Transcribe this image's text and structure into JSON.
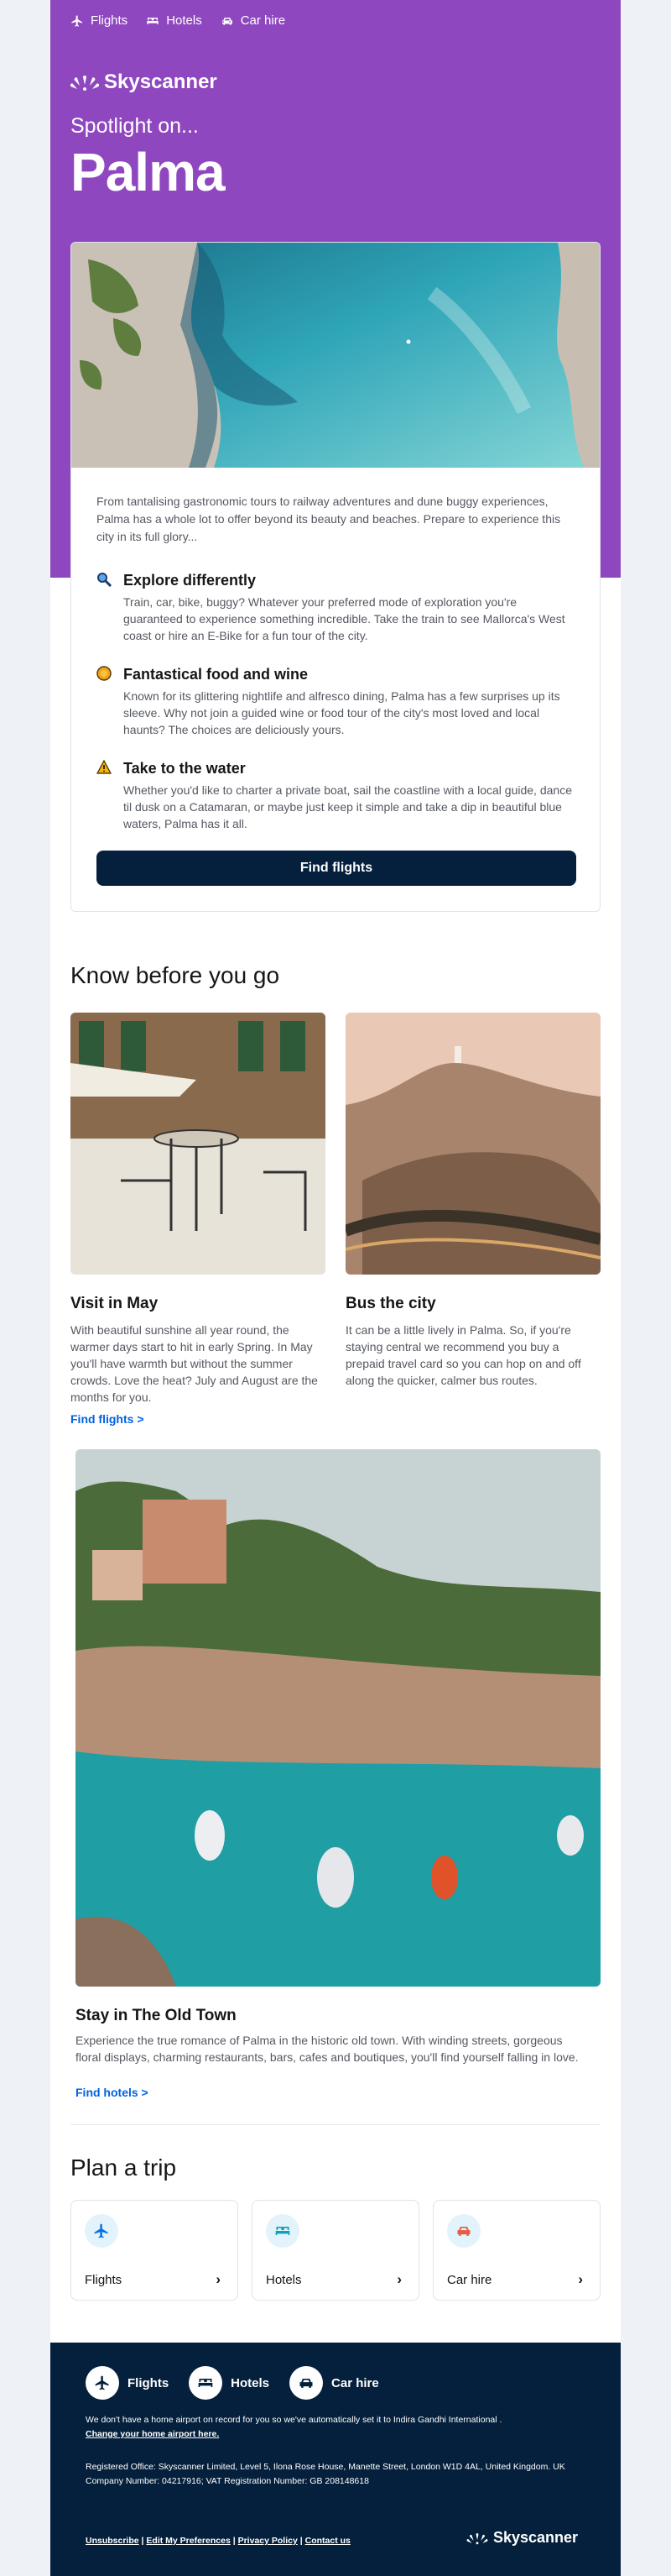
{
  "topnav": {
    "items": [
      {
        "label": "Flights",
        "icon": "plane-icon"
      },
      {
        "label": "Hotels",
        "icon": "bed-icon"
      },
      {
        "label": "Car hire",
        "icon": "car-icon"
      }
    ]
  },
  "brand": {
    "name": "Skyscanner",
    "purple": "#8f47c0",
    "navy": "#05203c",
    "link_blue": "#0062e3"
  },
  "hero": {
    "kicker": "Spotlight on...",
    "city": "Palma"
  },
  "intro": "From tantalising gastronomic tours to railway adventures and dune buggy experiences, Palma has a whole lot to offer beyond its beauty and beaches. Prepare to experience this city in its full glory...",
  "features": [
    {
      "title": "Explore differently",
      "icon": "magnifier-icon",
      "text": "Train, car, bike, buggy? Whatever your preferred mode of exploration you're guaranteed to experience something incredible. Take the train to see Mallorca's West coast or hire an E-Bike for a fun tour of the city."
    },
    {
      "title": "Fantastical food and wine",
      "icon": "food-icon",
      "text": "Known for its glittering nightlife and alfresco dining, Palma has a few surprises up its sleeve. Why not join a guided wine or food tour of the city's most loved and local haunts? The choices are deliciously yours."
    },
    {
      "title": "Take to the water",
      "icon": "warning-icon",
      "text": "Whether you'd like to charter a private boat, sail the coastline with a local guide, dance til dusk on a Catamaran, or maybe just keep it simple and take a dip in beautiful blue waters, Palma has it all."
    }
  ],
  "cta": {
    "label": "Find flights"
  },
  "know": {
    "title": "Know before you go",
    "tiles": [
      {
        "title": "Visit in May",
        "text": "With beautiful sunshine all year round, the warmer days start to hit in early Spring. In May you'll have warmth but without the summer crowds. Love the heat? July and August are the months for you.",
        "link": "Find flights >"
      },
      {
        "title": "Bus the city",
        "text": "It can be a little lively in Palma. So, if you're staying central we recommend you buy a prepaid travel card so you can hop on and off along the quicker, calmer bus routes."
      }
    ],
    "feature": {
      "title": "Stay in The Old Town",
      "text": "Experience the true romance of Palma in the historic old town. With winding streets, gorgeous floral displays, charming restaurants, bars, cafes and boutiques, you'll find yourself falling in love.",
      "link": "Find hotels >"
    }
  },
  "plan": {
    "title": "Plan a trip",
    "cards": [
      {
        "label": "Flights",
        "icon": "plane-icon",
        "chevron": "›"
      },
      {
        "label": "Hotels",
        "icon": "bed-icon",
        "chevron": "›"
      },
      {
        "label": "Car hire",
        "icon": "car-icon",
        "chevron": "›"
      }
    ]
  },
  "footer": {
    "nav": [
      {
        "label": "Flights",
        "icon": "plane-icon"
      },
      {
        "label": "Hotels",
        "icon": "bed-icon"
      },
      {
        "label": "Car hire",
        "icon": "car-icon"
      }
    ],
    "airport_note": "We don't have a home airport on record for you so we've automatically set it to Indira Gandhi International .",
    "change_airport": "Change your home airport here.",
    "registered": "Registered Office: Skyscanner Limited, Level 5, Ilona Rose House, Manette Street, London W1D 4AL, United Kingdom. UK Company Number: 04217916; VAT Registration Number: GB 208148618",
    "links": [
      "Unsubscribe",
      "Edit My Preferences",
      "Privacy Policy",
      "Contact us"
    ],
    "separator": "|"
  }
}
